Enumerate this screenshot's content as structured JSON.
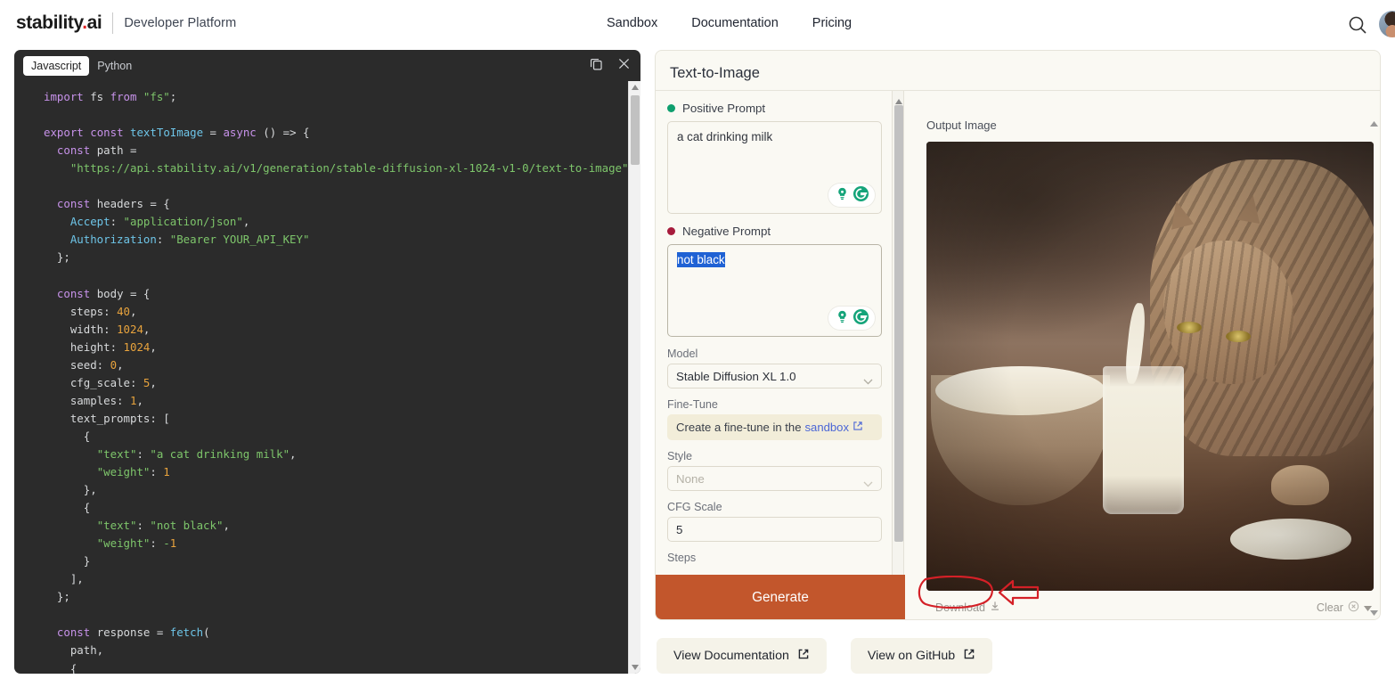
{
  "header": {
    "logo_main": "stability",
    "logo_dot": ".",
    "logo_ai": "ai",
    "logo_sub": "Developer Platform",
    "nav": [
      {
        "label": "Sandbox"
      },
      {
        "label": "Documentation"
      },
      {
        "label": "Pricing"
      }
    ],
    "search_icon": "search-icon",
    "avatar": "user-avatar"
  },
  "code_panel": {
    "tabs": [
      {
        "label": "Javascript",
        "active": true
      },
      {
        "label": "Python",
        "active": false
      }
    ],
    "copy_icon": "copy-icon",
    "close_icon": "close-icon",
    "language": "Javascript",
    "source": "import fs from \"fs\";\n\nexport const textToImage = async () => {\n  const path =\n    \"https://api.stability.ai/v1/generation/stable-diffusion-xl-1024-v1-0/text-to-image\";\n\n  const headers = {\n    Accept: \"application/json\",\n    Authorization: \"Bearer YOUR_API_KEY\"\n  };\n\n  const body = {\n    steps: 40,\n    width: 1024,\n    height: 1024,\n    seed: 0,\n    cfg_scale: 5,\n    samples: 1,\n    text_prompts: [\n      {\n        \"text\": \"a cat drinking milk\",\n        \"weight\": 1\n      },\n      {\n        \"text\": \"not black\",\n        \"weight\": -1\n      }\n    ],\n  };\n\n  const response = fetch(\n    path,\n    {"
  },
  "app": {
    "title": "Text-to-Image",
    "positive_prompt": {
      "label": "Positive Prompt",
      "value": "a cat drinking milk",
      "dot_color": "#0e9f6e"
    },
    "negative_prompt": {
      "label": "Negative Prompt",
      "value": "not black",
      "selected": true,
      "dot_color": "#a61b3c"
    },
    "model": {
      "label": "Model",
      "value": "Stable Diffusion XL 1.0"
    },
    "fine_tune": {
      "label": "Fine-Tune",
      "text_before": "Create a fine-tune in the",
      "link_label": "sandbox"
    },
    "style": {
      "label": "Style",
      "value": "None",
      "disabled": true
    },
    "cfg_scale": {
      "label": "CFG Scale",
      "value": "5"
    },
    "steps": {
      "label": "Steps"
    },
    "generate_label": "Generate",
    "output": {
      "label": "Output Image",
      "image_alt": "a cat drinking milk from a glass next to a bowl on a wooden table",
      "download_label": "Download",
      "clear_label": "Clear"
    }
  },
  "bottom_buttons": [
    {
      "label": "View Documentation",
      "icon": "external-link-icon"
    },
    {
      "label": "View on GitHub",
      "icon": "external-link-icon"
    }
  ],
  "annotations": {
    "circle_target": "Download",
    "arrow_direction": "left",
    "color": "#d42027"
  }
}
